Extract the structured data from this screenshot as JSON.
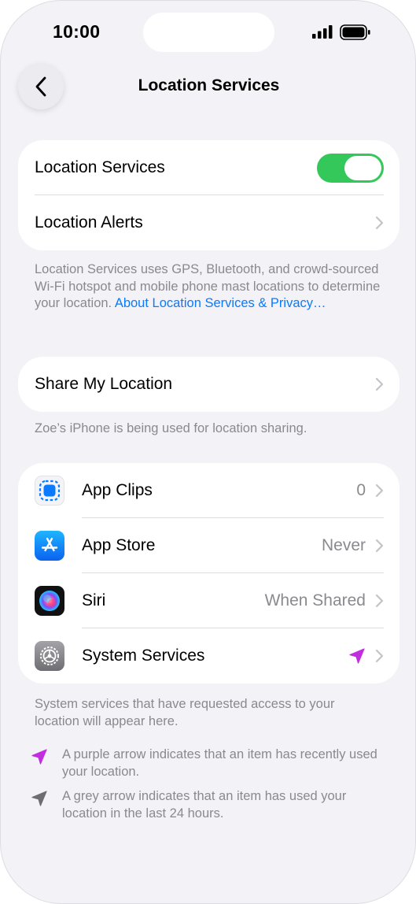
{
  "status_bar": {
    "time": "10:00",
    "signal_icon": "signal-bars-icon",
    "battery_icon": "battery-icon"
  },
  "nav": {
    "title": "Location Services",
    "back_icon": "chevron-left-icon"
  },
  "group_main": {
    "location_services": {
      "label": "Location Services",
      "toggle_on": true
    },
    "location_alerts": {
      "label": "Location Alerts"
    }
  },
  "footnote_main": {
    "text": "Location Services uses GPS, Bluetooth, and crowd-sourced Wi-Fi hotspot and mobile phone mast locations to determine your location. ",
    "link": "About Location Services & Privacy…"
  },
  "group_share": {
    "label": "Share My Location"
  },
  "footnote_share": "Zoe’s iPhone is being used for location sharing.",
  "apps": [
    {
      "label": "App Clips",
      "value": "0",
      "icon": "app-clips-icon"
    },
    {
      "label": "App Store",
      "value": "Never",
      "icon": "app-store-icon"
    },
    {
      "label": "Siri",
      "value": "When Shared",
      "icon": "siri-icon"
    },
    {
      "label": "System Services",
      "value": "",
      "icon": "settings-gear-icon",
      "indicator": "purple-location-arrow-icon"
    }
  ],
  "footnote_system": "System services that have requested access to your location will appear here.",
  "legend": [
    {
      "text": "A purple arrow indicates that an item has recently used your location.",
      "icon": "purple-location-arrow-icon"
    },
    {
      "text": "A grey arrow indicates that an item has used your location in the last 24 hours.",
      "icon": "grey-location-arrow-icon"
    }
  ],
  "colors": {
    "accent": "#0a7aff",
    "toggle_on": "#34c759",
    "purple_arrow": "#c22de0",
    "grey_arrow": "#6d6d72",
    "background": "#f2f2f7"
  }
}
